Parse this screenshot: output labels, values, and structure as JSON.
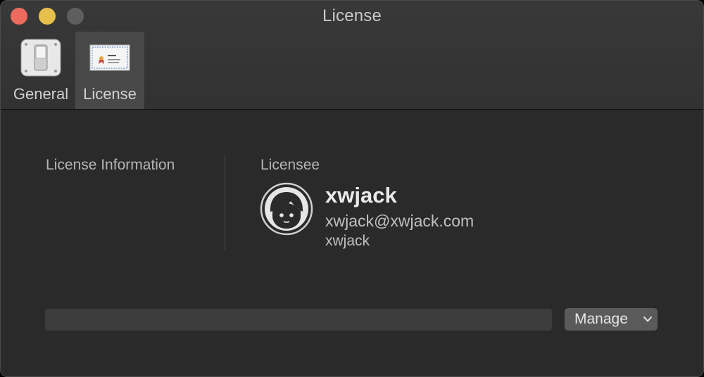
{
  "window": {
    "title": "License",
    "controls": [
      "close",
      "minimize",
      "zoom"
    ]
  },
  "toolbar": {
    "tabs": [
      {
        "label": "General",
        "icon": "toggle-switch-icon",
        "selected": false
      },
      {
        "label": "License",
        "icon": "certificate-icon",
        "selected": true
      }
    ]
  },
  "license": {
    "section_label": "License Information",
    "licensee_label": "Licensee",
    "name": "xwjack",
    "email": "xwjack@xwjack.com",
    "id": "xwjack",
    "key_value": "",
    "manage_label": "Manage"
  },
  "colors": {
    "close": "#ed6a5e",
    "minimize": "#e6bf4c",
    "zoom": "#5e5e5e",
    "window_bg": "#2a2a2a"
  }
}
